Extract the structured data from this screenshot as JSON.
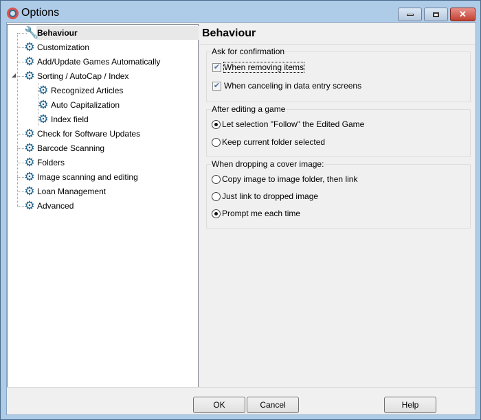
{
  "window": {
    "title": "Options"
  },
  "tree": {
    "items": [
      {
        "label": "Behaviour",
        "icon": "wrench-icon",
        "level": 1,
        "selected": true
      },
      {
        "label": "Customization",
        "icon": "gear-icon",
        "level": 1
      },
      {
        "label": "Add/Update Games Automatically",
        "icon": "gear-icon",
        "level": 1
      },
      {
        "label": "Sorting / AutoCap / Index",
        "icon": "gear-icon",
        "level": 1,
        "expanded": true
      },
      {
        "label": "Recognized Articles",
        "icon": "gear-icon",
        "level": 2
      },
      {
        "label": "Auto Capitalization",
        "icon": "gear-icon",
        "level": 2
      },
      {
        "label": "Index field",
        "icon": "gear-icon",
        "level": 2
      },
      {
        "label": "Check for Software Updates",
        "icon": "gear-icon",
        "level": 1
      },
      {
        "label": "Barcode Scanning",
        "icon": "gear-icon",
        "level": 1
      },
      {
        "label": "Folders",
        "icon": "gear-icon",
        "level": 1
      },
      {
        "label": "Image scanning and editing",
        "icon": "gear-icon",
        "level": 1
      },
      {
        "label": "Loan Management",
        "icon": "gear-icon",
        "level": 1
      },
      {
        "label": "Advanced",
        "icon": "gear-icon",
        "level": 1
      }
    ]
  },
  "panel": {
    "title": "Behaviour",
    "confirm": {
      "title": "Ask for confirmation",
      "removing": "When removing items",
      "canceling": "When canceling in data entry screens"
    },
    "after_edit": {
      "title": "After editing a game",
      "follow": "Let selection \"Follow\" the Edited Game",
      "keep": "Keep current folder selected"
    },
    "cover": {
      "title": "When dropping a cover image:",
      "copy": "Copy image to image folder, then link",
      "link": "Just link to dropped image",
      "prompt": "Prompt me each time"
    }
  },
  "buttons": {
    "ok": "OK",
    "cancel": "Cancel",
    "help": "Help"
  }
}
